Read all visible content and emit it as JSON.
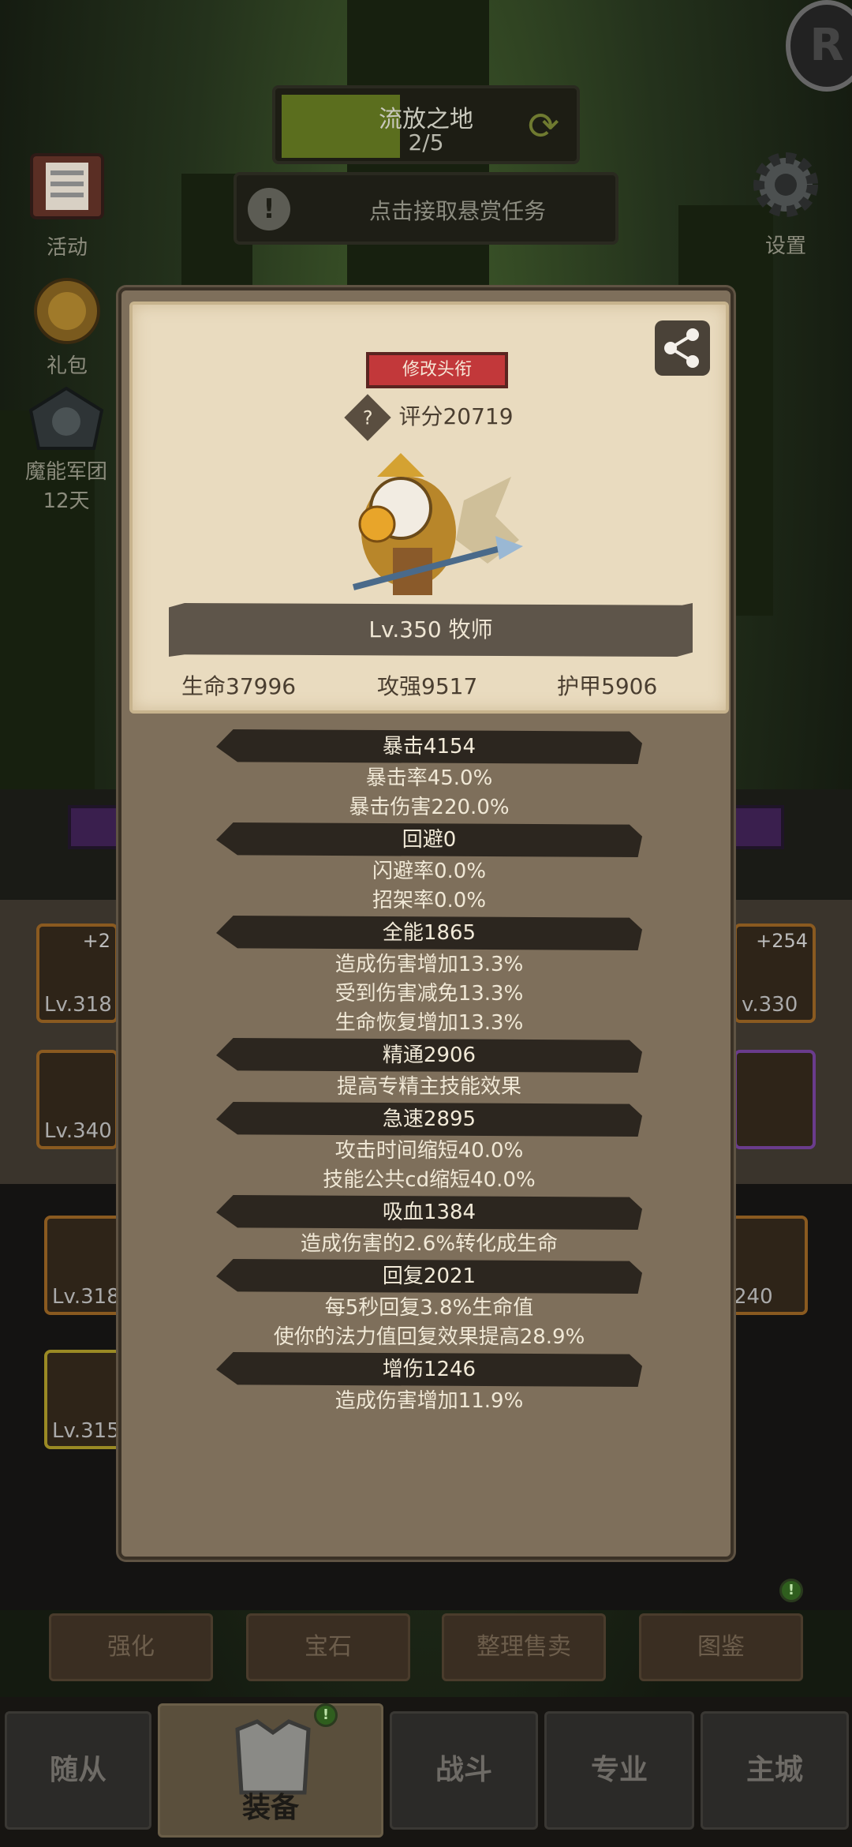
{
  "hud": {
    "zone_name": "流放之地",
    "zone_progress": "2/5",
    "zone_progress_fraction": 0.4,
    "bounty_text": "点击接取悬赏任务",
    "alert_glyph": "!",
    "swap_icon": "refresh-icon"
  },
  "side_buttons": {
    "activity": "活动",
    "gift": "礼包",
    "legion": "魔能军团",
    "legion_days": "12天",
    "settings": "设置"
  },
  "background_slots": {
    "left_plus": "+2",
    "right_plus": "+254",
    "lv_a": "Lv.318",
    "lv_b": "Lv.340",
    "lv_c": "Lv.318",
    "lv_d": "Lv.315",
    "lv_e": "v.330",
    "lv_f": "240"
  },
  "profile": {
    "title_button": "修改头衔",
    "score_glyph": "?",
    "score": "评分20719",
    "level_class": "Lv.350 牧师",
    "hp": "生命37996",
    "attack": "攻强9517",
    "armor": "护甲5906"
  },
  "stats": [
    {
      "head": "暴击4154",
      "subs": [
        "暴击率45.0%",
        "暴击伤害220.0%"
      ]
    },
    {
      "head": "回避0",
      "subs": [
        "闪避率0.0%",
        "招架率0.0%"
      ]
    },
    {
      "head": "全能1865",
      "subs": [
        "造成伤害增加13.3%",
        "受到伤害减免13.3%",
        "生命恢复增加13.3%"
      ]
    },
    {
      "head": "精通2906",
      "subs": [
        "提高专精主技能效果"
      ]
    },
    {
      "head": "急速2895",
      "subs": [
        "攻击时间缩短40.0%",
        "技能公共cd缩短40.0%"
      ]
    },
    {
      "head": "吸血1384",
      "subs": [
        "造成伤害的2.6%转化成生命"
      ]
    },
    {
      "head": "回复2021",
      "subs": [
        "每5秒回复3.8%生命值",
        "使你的法力值回复效果提高28.9%"
      ]
    },
    {
      "head": "增伤1246",
      "subs": [
        "造成伤害增加11.9%"
      ]
    }
  ],
  "sub_tabs": [
    "强化",
    "宝石",
    "整理售卖",
    "图鉴"
  ],
  "nav": {
    "followers": "随从",
    "equipment": "装备",
    "battle": "战斗",
    "profession": "专业",
    "main_city": "主城"
  },
  "colors": {
    "title_button": "#c2383a",
    "card": "#e9dbbf",
    "dialog": "#7e6f5b",
    "zone_fill": "#5b6e1e"
  }
}
